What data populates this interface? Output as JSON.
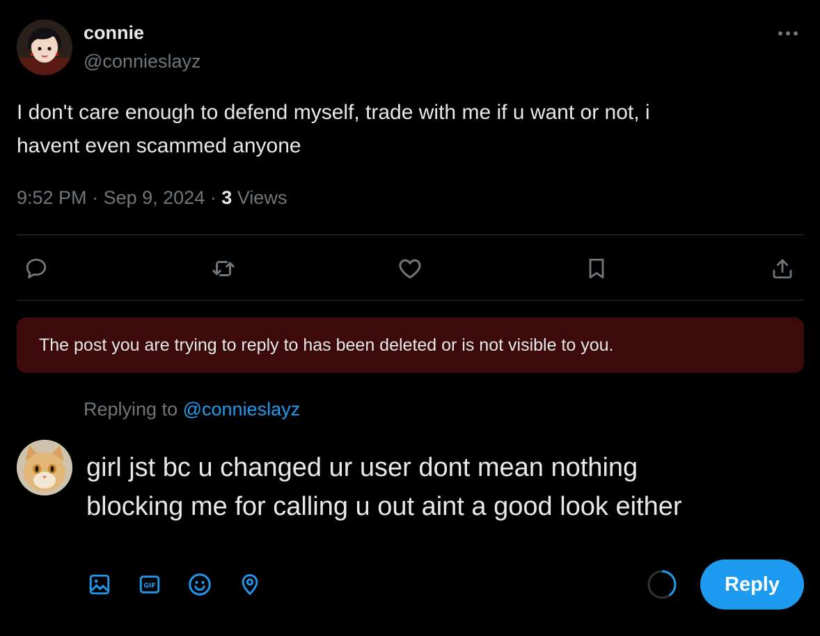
{
  "post": {
    "author_name": "connie",
    "author_handle": "@connieslayz",
    "text_line1": "I don't care enough to defend myself, trade with me if u want or not, i",
    "text_line2": "havent even scammed anyone",
    "time": "9:52 PM",
    "date": "Sep 9, 2024",
    "views_count": "3",
    "views_label": "Views"
  },
  "notice": {
    "text": "The post you are trying to reply to has been deleted or is not visible to you."
  },
  "reply": {
    "replying_to_label": "Replying to",
    "replying_to_handle": "@connieslayz",
    "draft_line1": "girl jst bc u changed ur user dont mean nothing",
    "draft_line2": "blocking me for calling u out aint a good look either",
    "button_label": "Reply"
  },
  "actions": [
    "reply-icon",
    "repost-icon",
    "like-icon",
    "bookmark-icon",
    "share-icon"
  ],
  "composer_tools": [
    "image-icon",
    "gif-icon",
    "emoji-icon",
    "location-icon"
  ],
  "colors": {
    "background": "#000000",
    "text": "#e7e9ea",
    "muted": "#71767b",
    "accent": "#1d9bf0",
    "notice_bg": "#3c0a0a",
    "divider": "#2f3336"
  }
}
